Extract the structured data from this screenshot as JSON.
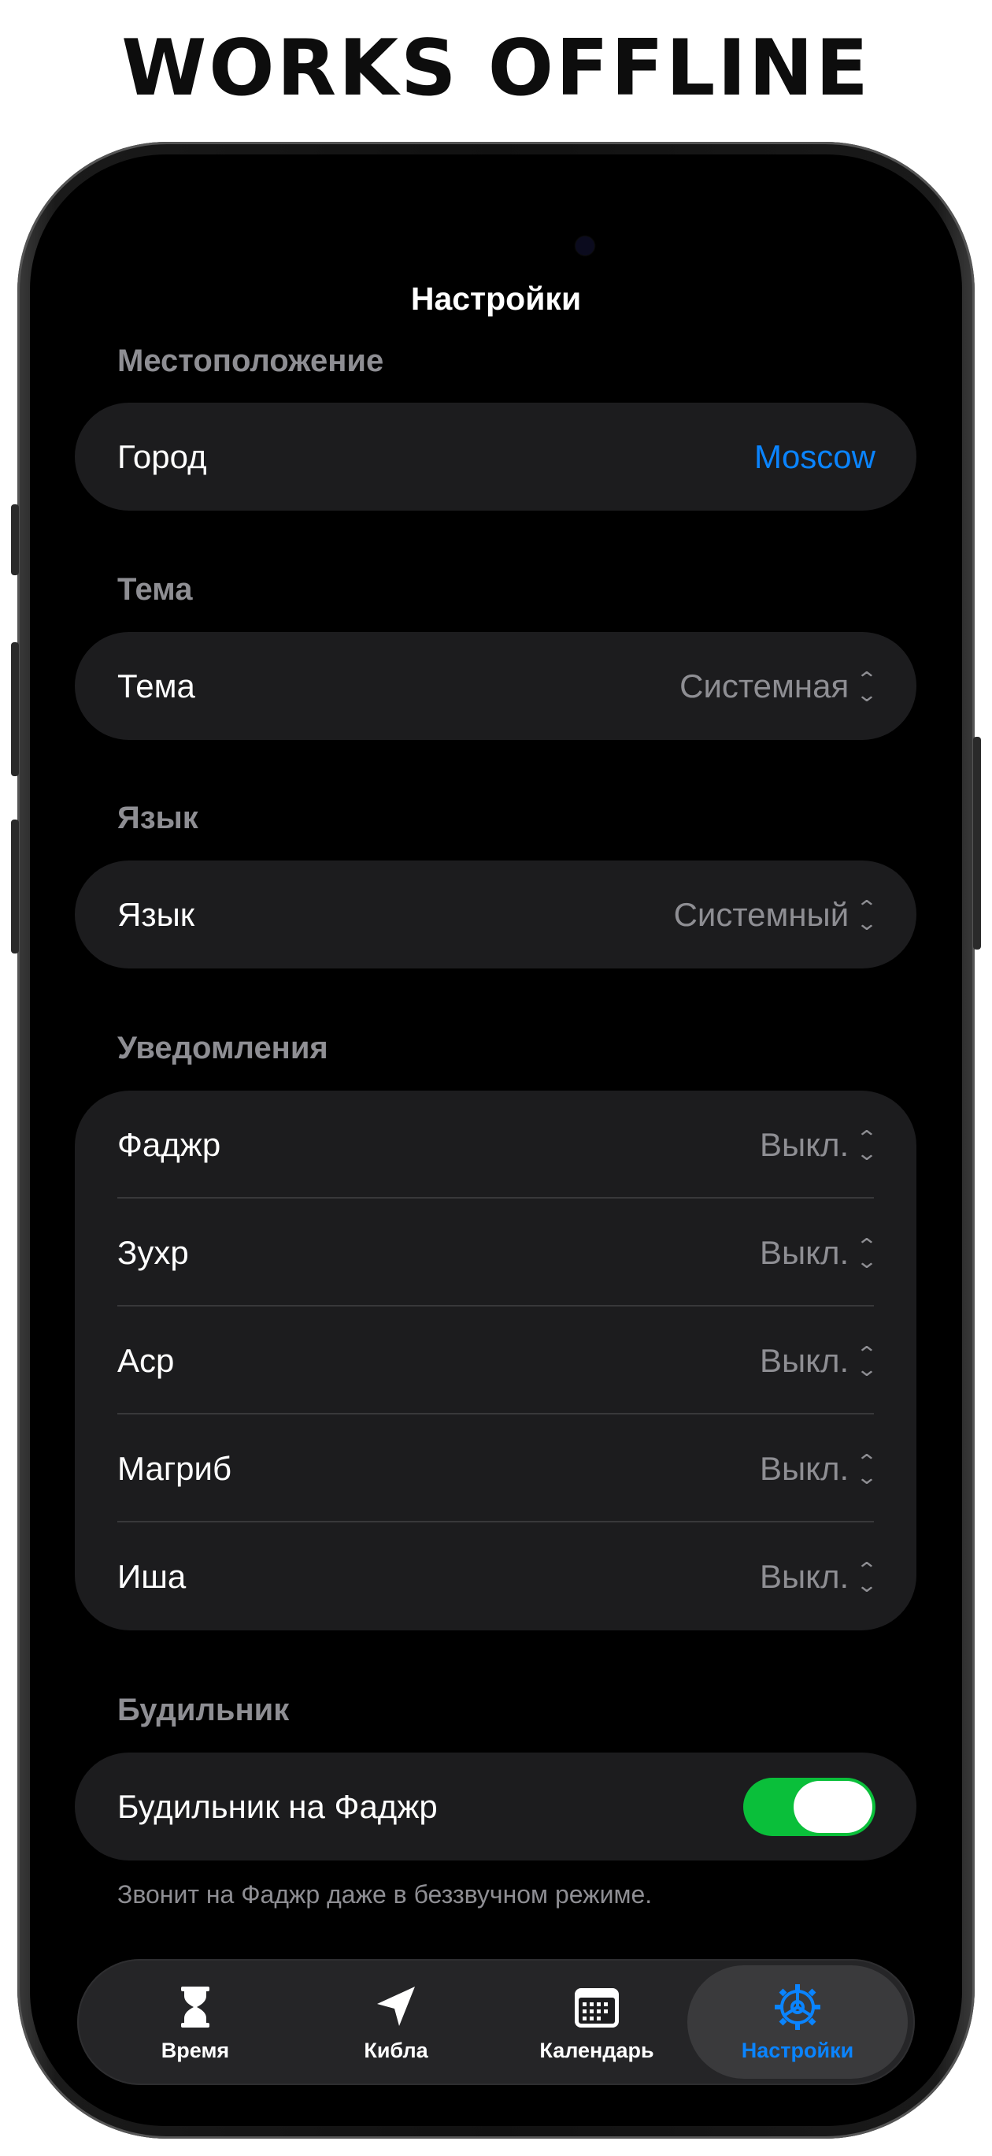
{
  "headline": "WORKS OFFLINE",
  "screen_title": "Настройки",
  "sections": {
    "location": {
      "header": "Местоположение",
      "city_label": "Город",
      "city_value": "Moscow"
    },
    "theme": {
      "header": "Тема",
      "label": "Тема",
      "value": "Системная"
    },
    "language": {
      "header": "Язык",
      "label": "Язык",
      "value": "Системный"
    },
    "notifications": {
      "header": "Уведомления",
      "rows": [
        {
          "label": "Фаджр",
          "value": "Выкл."
        },
        {
          "label": "Зухр",
          "value": "Выкл."
        },
        {
          "label": "Аср",
          "value": "Выкл."
        },
        {
          "label": "Магриб",
          "value": "Выкл."
        },
        {
          "label": "Иша",
          "value": "Выкл."
        }
      ]
    },
    "alarm": {
      "header": "Будильник",
      "label": "Будильник на Фаджр",
      "toggle_on": true,
      "footnote": "Звонит на Фаджр даже в беззвучном режиме."
    }
  },
  "tabbar": {
    "tabs": [
      {
        "label": "Время",
        "icon": "hourglass-icon"
      },
      {
        "label": "Кибла",
        "icon": "location-arrow-icon"
      },
      {
        "label": "Календарь",
        "icon": "calendar-icon"
      },
      {
        "label": "Настройки",
        "icon": "gear-icon",
        "active": true
      }
    ]
  },
  "colors": {
    "accent": "#0a84ff",
    "toggle_on": "#0abf3a",
    "background": "#000000",
    "card": "#1c1c1e",
    "secondary_text": "#8e8e93"
  }
}
